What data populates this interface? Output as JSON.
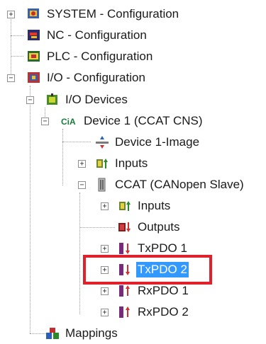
{
  "tree": {
    "system": "SYSTEM - Configuration",
    "nc": "NC - Configuration",
    "plc": "PLC - Configuration",
    "io": "I/O - Configuration",
    "io_devices": "I/O Devices",
    "device1": "Device 1 (CCAT CNS)",
    "device1_image": "Device 1-Image",
    "inputs_dev": "Inputs",
    "ccat": "CCAT (CANopen Slave)",
    "ccat_inputs": "Inputs",
    "ccat_outputs": "Outputs",
    "txpdo1": "TxPDO 1",
    "txpdo2": "TxPDO 2",
    "rxpdo1": "RxPDO 1",
    "rxpdo2": "RxPDO 2",
    "mappings": "Mappings",
    "cia_badge": "CiA"
  },
  "icons": {
    "system": "system-config-icon",
    "nc": "nc-config-icon",
    "plc": "plc-config-icon",
    "io": "io-config-icon",
    "io_devices": "io-devices-icon",
    "device": "canopen-device-icon",
    "image": "process-image-icon",
    "inputs": "inputs-icon",
    "box": "canopen-slave-icon",
    "outputs": "outputs-icon",
    "txpdo": "txpdo-icon",
    "rxpdo": "rxpdo-icon",
    "mappings": "mappings-icon"
  },
  "colors": {
    "selection": "#3399ff",
    "highlight_border": "#e0202a"
  }
}
